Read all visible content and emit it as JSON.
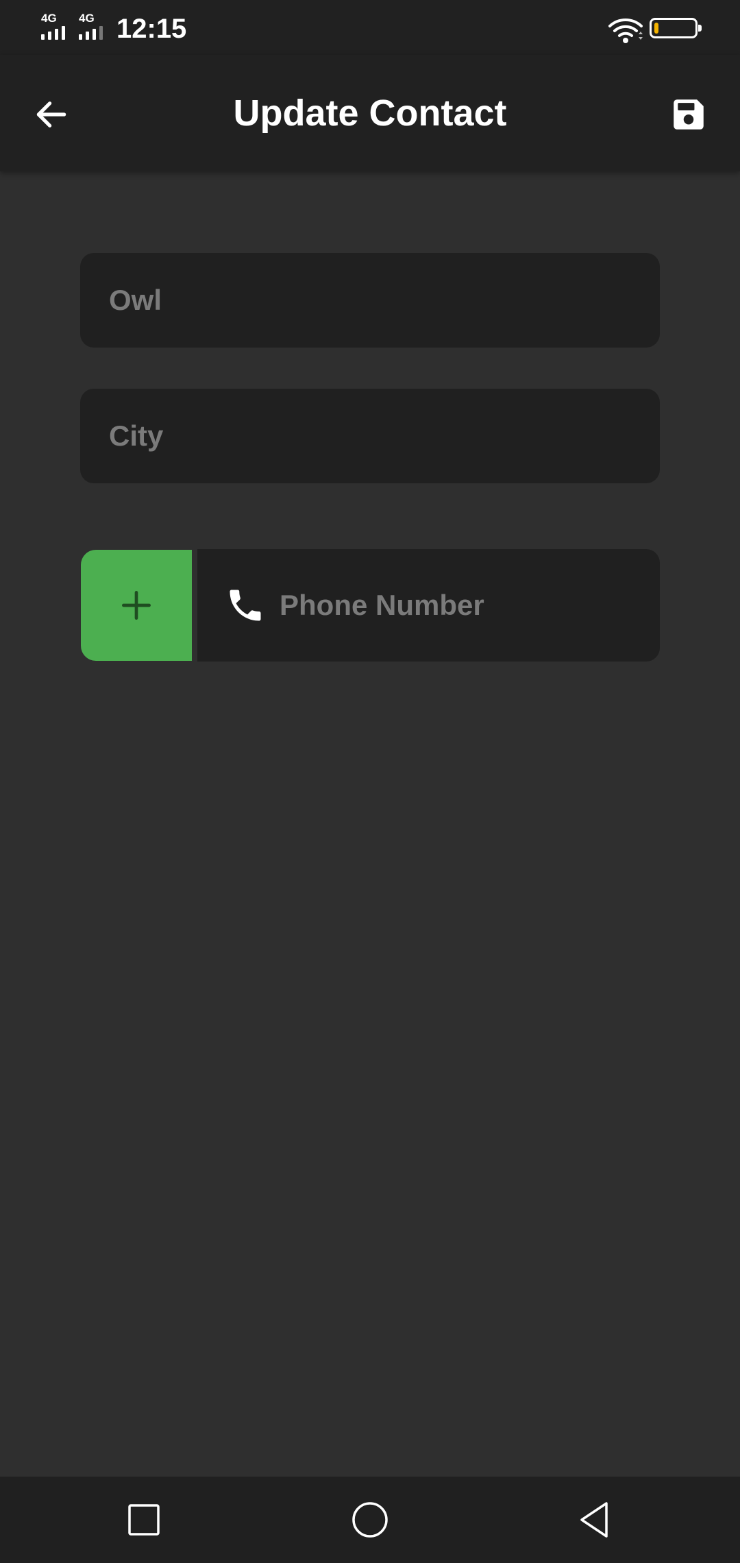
{
  "status_bar": {
    "network_1": "4G",
    "network_2": "4G",
    "time": "12:15",
    "battery_level_percent": 10,
    "icons": [
      "signal-icon",
      "wifi-icon",
      "battery-icon"
    ]
  },
  "app_bar": {
    "title": "Update Contact",
    "back_icon": "arrow-left-icon",
    "save_icon": "floppy-disk-icon"
  },
  "form": {
    "name_field": {
      "value": "",
      "placeholder": "Owl"
    },
    "city_field": {
      "value": "",
      "placeholder": "City"
    },
    "phone_field": {
      "value": "",
      "placeholder": "Phone Number",
      "icon": "phone-icon"
    },
    "add_phone_icon": "plus-icon"
  },
  "nav_bar": {
    "icons": [
      "square-recents-icon",
      "circle-home-icon",
      "triangle-back-icon"
    ]
  },
  "colors": {
    "background": "#2f2f2f",
    "bar": "#212121",
    "field": "#202020",
    "accent_green": "#4caf50",
    "placeholder": "#7b7b7b",
    "battery": "#f5b400"
  }
}
